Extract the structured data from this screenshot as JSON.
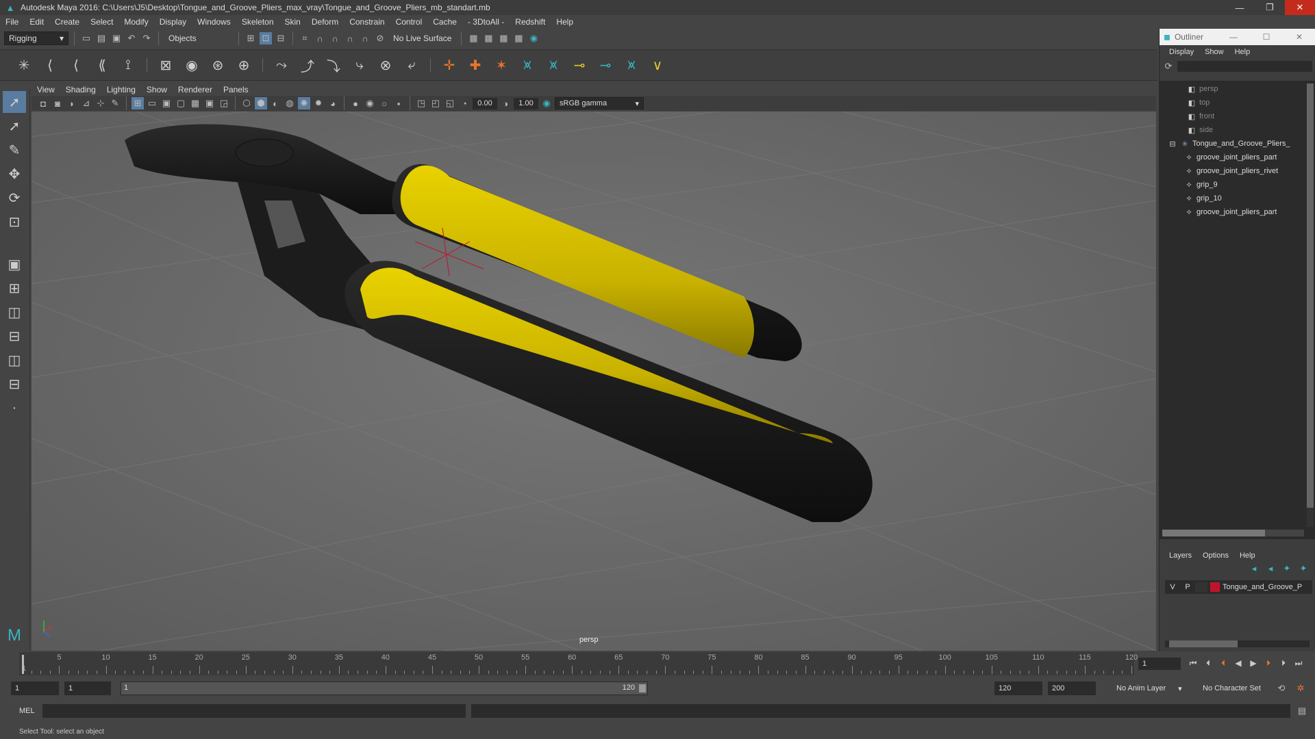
{
  "window": {
    "title": "Autodesk Maya 2016: C:\\Users\\J5\\Desktop\\Tongue_and_Groove_Pliers_max_vray\\Tongue_and_Groove_Pliers_mb_standart.mb"
  },
  "menu": [
    "File",
    "Edit",
    "Create",
    "Select",
    "Modify",
    "Display",
    "Windows",
    "Skeleton",
    "Skin",
    "Deform",
    "Constrain",
    "Control",
    "Cache",
    "- 3DtoAll -",
    "Redshift",
    "Help"
  ],
  "status": {
    "menuset": "Rigging",
    "select_mode": "Objects",
    "live_surface": "No Live Surface"
  },
  "panel": {
    "menus": [
      "View",
      "Shading",
      "Lighting",
      "Show",
      "Renderer",
      "Panels"
    ],
    "near": "0.00",
    "far": "1.00",
    "colorspace": "sRGB gamma",
    "camera": "persp"
  },
  "outliner": {
    "title": "Outliner",
    "menus": [
      "Display",
      "Show",
      "Help"
    ],
    "items": [
      {
        "label": "persp",
        "kind": "camera"
      },
      {
        "label": "top",
        "kind": "camera"
      },
      {
        "label": "front",
        "kind": "camera"
      },
      {
        "label": "side",
        "kind": "camera"
      },
      {
        "label": "Tongue_and_Groove_Pliers_",
        "kind": "group"
      },
      {
        "label": "groove_joint_pliers_part",
        "kind": "mesh"
      },
      {
        "label": "groove_joint_pliers_rivet",
        "kind": "mesh"
      },
      {
        "label": "grip_9",
        "kind": "mesh"
      },
      {
        "label": "grip_10",
        "kind": "mesh"
      },
      {
        "label": "groove_joint_pliers_part",
        "kind": "mesh"
      }
    ]
  },
  "layers": {
    "menus": [
      "Layers",
      "Options",
      "Help"
    ],
    "row": {
      "v": "V",
      "p": "P",
      "name": "Tongue_and_Groove_P",
      "color": "#c0142c"
    }
  },
  "timeline": {
    "ticks": [
      "1",
      "5",
      "10",
      "15",
      "20",
      "25",
      "30",
      "35",
      "40",
      "45",
      "50",
      "55",
      "60",
      "65",
      "70",
      "75",
      "80",
      "85",
      "90",
      "95",
      "100",
      "105",
      "110",
      "115",
      "120"
    ],
    "current_frame": "1"
  },
  "range": {
    "start": "1",
    "anim_start": "1",
    "slider_start": "1",
    "slider_end": "120",
    "anim_end": "120",
    "end": "200",
    "anim_layer": "No Anim Layer",
    "char_set": "No Character Set"
  },
  "cmd": {
    "label": "MEL"
  },
  "help": {
    "text": "Select Tool: select an object"
  },
  "colors": {
    "handle_yellow": "#d9c300",
    "handle_black": "#1a1a1a",
    "viewport_bg": "#6b6b6b"
  }
}
